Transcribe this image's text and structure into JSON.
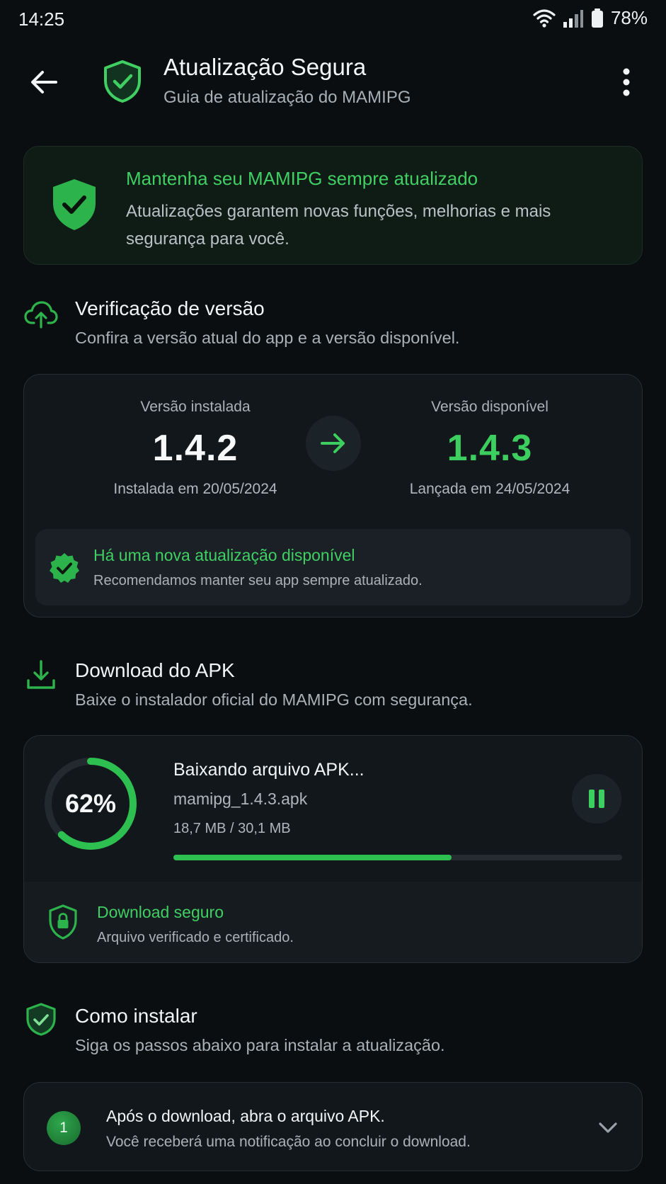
{
  "status_bar": {
    "time": "14:25",
    "battery": "78%",
    "icons": [
      "wifi-icon",
      "signal-icon",
      "battery-icon"
    ]
  },
  "header": {
    "title": "Atualização Segura",
    "subtitle": "Guia de atualização do MAMIPG",
    "icons": [
      "back-arrow-icon",
      "shield-check-icon",
      "more-vertical-icon"
    ]
  },
  "banner": {
    "title": "Mantenha seu MAMIPG sempre atualizado",
    "text": "Atualizações garantem novas funções, melhorias e mais segurança para você."
  },
  "version_section": {
    "title": "Verificação de versão",
    "subtitle": "Confira a versão atual do app e a versão disponível.",
    "installed_label": "Versão instalada",
    "installed_version": "1.4.2",
    "installed_date": "Instalada em 20/05/2024",
    "available_label": "Versão disponível",
    "available_version": "1.4.3",
    "available_date": "Lançada em 24/05/2024",
    "notice_title": "Há uma nova atualização disponível",
    "notice_text": "Recomendamos manter seu app sempre atualizado."
  },
  "download_section": {
    "title": "Download do APK",
    "subtitle": "Baixe o instalador oficial do MAMIPG com segurança.",
    "progress_label": "62%",
    "progress_fraction": 0.62,
    "status": "Baixando arquivo APK...",
    "filename": "mamipg_1.4.3.apk",
    "size": "18,7 MB / 30,1 MB",
    "secure_title": "Download seguro",
    "secure_text": "Arquivo verificado e certificado."
  },
  "install_section": {
    "title": "Como instalar",
    "subtitle": "Siga os passos abaixo para instalar a atualização.",
    "steps": [
      {
        "number": "1",
        "title": "Após o download, abra o arquivo APK.",
        "text": "Você receberá uma notificação ao concluir o download."
      }
    ]
  },
  "colors": {
    "accent": "#3ccf5f",
    "background": "#0b0e11",
    "card": "#12171b"
  }
}
